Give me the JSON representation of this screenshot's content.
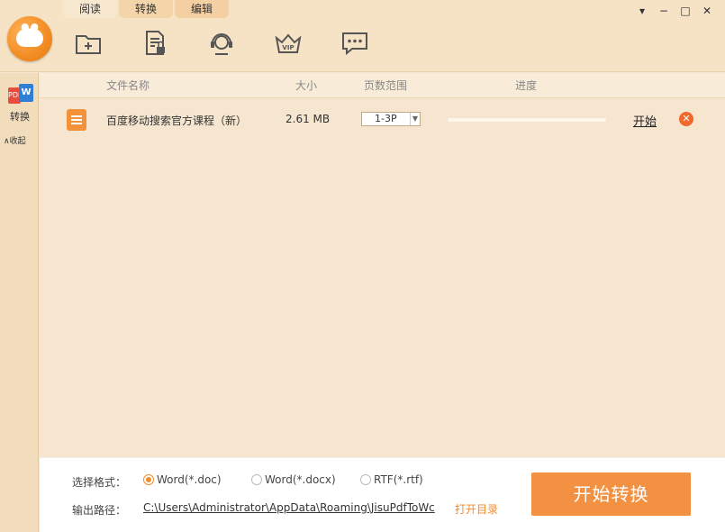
{
  "tabs": [
    {
      "label": "阅读"
    },
    {
      "label": "转换"
    },
    {
      "label": "编辑"
    }
  ],
  "toolbar": {
    "icons": [
      "add-folder-icon",
      "document-lock-icon",
      "support-headset-icon",
      "vip-crown-icon",
      "chat-bubble-icon"
    ]
  },
  "window_controls": {
    "menu": "▾",
    "minimize": "−",
    "maximize": "□",
    "close": "✕"
  },
  "sidebar": {
    "convert_label": "转换",
    "pdf_badge": "PDF",
    "word_badge": "W",
    "collapse_label": "∧收起"
  },
  "table": {
    "headers": [
      "文件名称",
      "大小",
      "页数范围",
      "进度"
    ],
    "rows": [
      {
        "name": "百度移动搜索官方课程（新）",
        "size": "2.61 MB",
        "range": "1-3P",
        "progress": 0,
        "action": "开始",
        "delete": "✕"
      }
    ]
  },
  "bottom": {
    "format_label": "选择格式：",
    "formats": [
      {
        "label": "Word(*.doc)",
        "checked": true
      },
      {
        "label": "Word(*.docx)",
        "checked": false
      },
      {
        "label": "RTF(*.rtf)",
        "checked": false
      }
    ],
    "output_label": "输出路径：",
    "output_path": "C:\\Users\\Administrator\\AppData\\Roaming\\JisuPdfToWc",
    "open_dir": "打开目录",
    "start_button": "开始转换"
  },
  "colors": {
    "accent": "#f08c2c",
    "background": "#f6e6cf"
  }
}
